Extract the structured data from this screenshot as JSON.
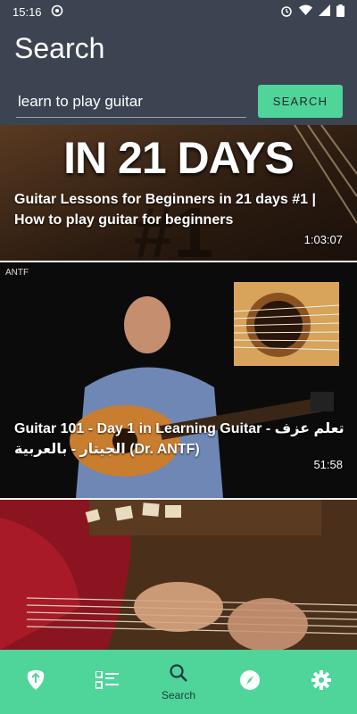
{
  "status": {
    "time": "15:16"
  },
  "header": {
    "title": "Search"
  },
  "search": {
    "value": "learn to play guitar",
    "button_label": "SEARCH"
  },
  "results": [
    {
      "title": "Guitar Lessons for Beginners in 21 days #1 | How to play guitar for beginners",
      "duration": "1:03:07",
      "thumbnail_text": "IN 21 DAYS"
    },
    {
      "title": "Guitar 101 - Day 1 in Learning Guitar - تعلم عزف الجيتار - بالعربية (Dr. ANTF)",
      "duration": "51:58",
      "watermark": "ANTF"
    },
    {
      "title": "",
      "duration": ""
    }
  ],
  "nav": {
    "items": [
      {
        "icon": "guitar-pick-icon",
        "label": ""
      },
      {
        "icon": "list-icon",
        "label": ""
      },
      {
        "icon": "search-icon",
        "label": "Search"
      },
      {
        "icon": "compass-icon",
        "label": ""
      },
      {
        "icon": "gear-icon",
        "label": ""
      }
    ]
  },
  "colors": {
    "header_bg": "#3c4452",
    "accent": "#4fd49a"
  }
}
